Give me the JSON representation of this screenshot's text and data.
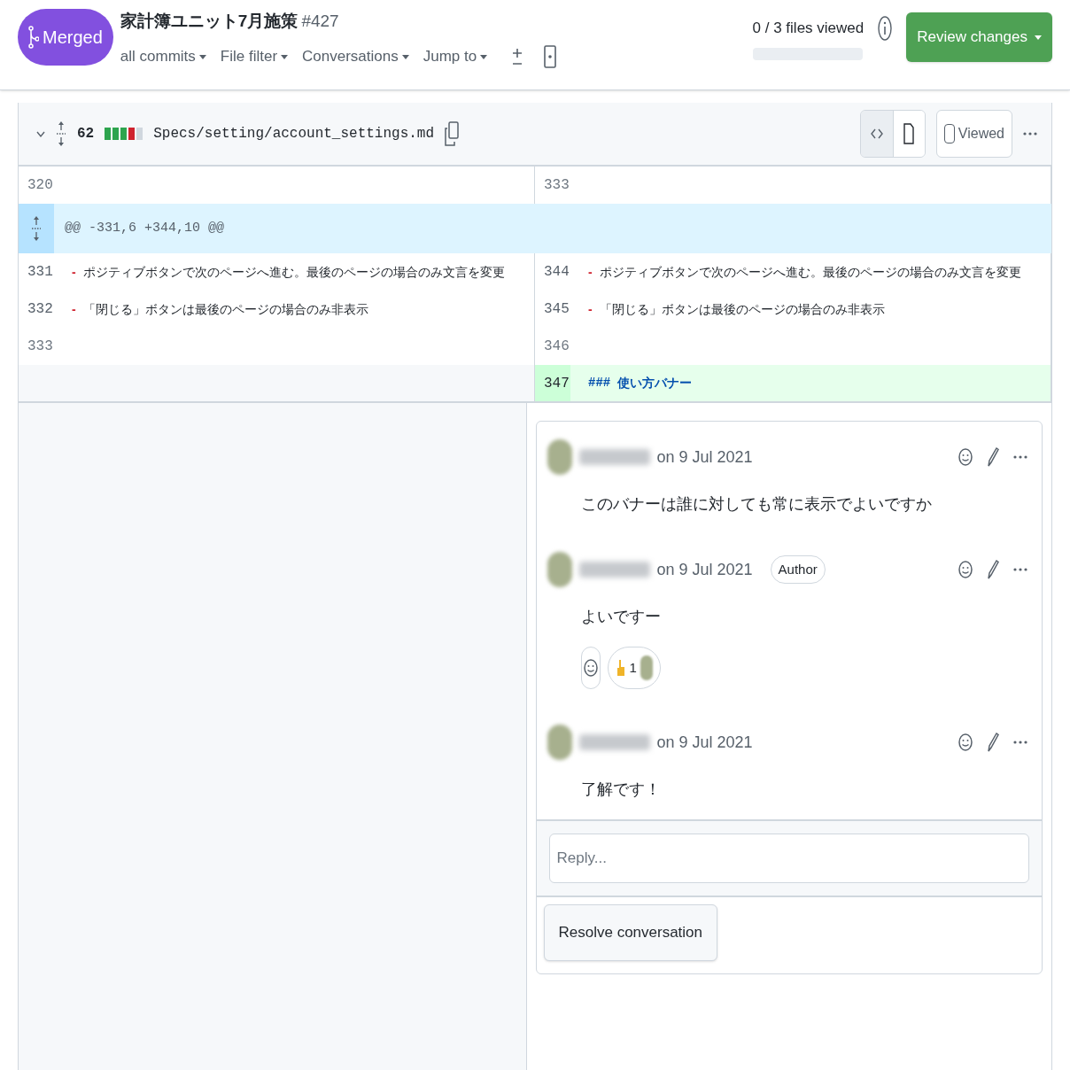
{
  "pr": {
    "state": "Merged",
    "title": "家計簿ユニット7月施策",
    "number": "#427"
  },
  "toolbar": [
    {
      "label": "all commits"
    },
    {
      "label": "File filter"
    },
    {
      "label": "Conversations"
    },
    {
      "label": "Jump to"
    }
  ],
  "progress": {
    "text": "0 / 3 files viewed",
    "level": 0
  },
  "review_button": "Review changes",
  "file": {
    "expanded": true,
    "changes": "62",
    "diffstat": [
      {
        "kind": "added"
      },
      {
        "kind": "added"
      },
      {
        "kind": "added"
      },
      {
        "kind": "deleted"
      },
      {
        "kind": "neutral"
      }
    ],
    "path": "Specs/setting/account_settings.md",
    "viewed": false,
    "viewed_label": "Viewed",
    "views": [
      {
        "selected": true
      },
      {
        "selected": false
      }
    ]
  },
  "rows": [
    {
      "kind": "line",
      "left": {
        "num": "320",
        "kind": "context",
        "added": false
      },
      "right": {
        "num": "333",
        "kind": "context",
        "added": false
      }
    },
    {
      "kind": "hunk",
      "text": "@@ -331,6 +344,10 @@"
    },
    {
      "kind": "line",
      "left": {
        "num": "331",
        "kind": "list",
        "added": false,
        "marker": "-",
        "text": "ポジティブボタンで次のページへ進む。最後のページの場合のみ文言を変更"
      },
      "right": {
        "num": "344",
        "kind": "list",
        "added": false,
        "marker": "-",
        "text": "ポジティブボタンで次のページへ進む。最後のページの場合のみ文言を変更"
      }
    },
    {
      "kind": "line",
      "left": {
        "num": "332",
        "kind": "list",
        "added": false,
        "marker": "-",
        "text": "「閉じる」ボタンは最後のページの場合のみ非表示"
      },
      "right": {
        "num": "345",
        "kind": "list",
        "added": false,
        "marker": "-",
        "text": "「閉じる」ボタンは最後のページの場合のみ非表示"
      }
    },
    {
      "kind": "line",
      "left": {
        "num": "333",
        "kind": "context",
        "added": false
      },
      "right": {
        "num": "346",
        "kind": "context",
        "added": false
      }
    },
    {
      "kind": "line",
      "right": {
        "num": "347",
        "kind": "heading",
        "added": true,
        "marker": "###",
        "text": "使い方バナー"
      }
    }
  ],
  "comments": [
    {
      "date": "on 9 Jul 2021",
      "body": "このバナーは誰に対しても常に表示でよいですか"
    },
    {
      "date": "on 9 Jul 2021",
      "badge": "Author",
      "body": "よいですー",
      "reactions": [
        {
          "count": "1"
        }
      ]
    },
    {
      "date": "on 9 Jul 2021",
      "body": "了解です！"
    }
  ],
  "reply": {
    "placeholder": "Reply..."
  },
  "resolve_button": "Resolve conversation"
}
